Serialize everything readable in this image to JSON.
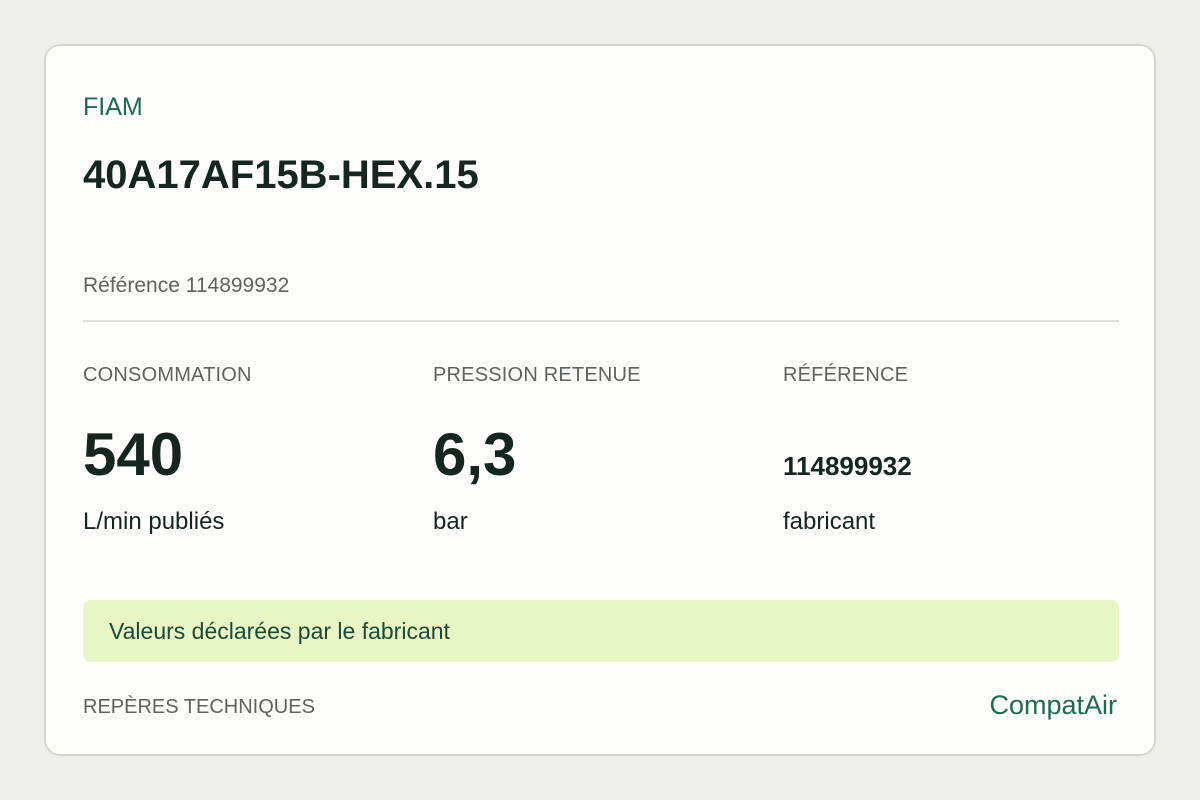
{
  "product": {
    "brand": "FIAM",
    "model": "40A17AF15B-HEX.15",
    "reference_line": "Référence 114899932"
  },
  "stats": [
    {
      "label": "CONSOMMATION",
      "value": "540",
      "unit": "L/min publiés"
    },
    {
      "label": "PRESSION RETENUE",
      "value": "6,3",
      "unit": "bar"
    },
    {
      "label": "RÉFÉRENCE",
      "value": "114899932",
      "unit": "fabricant"
    }
  ],
  "notice": "Valeurs déclarées par le fabricant",
  "footer": {
    "section_label": "REPÈRES TECHNIQUES",
    "site_name": "CompatAir"
  },
  "colors": {
    "accent": "#1f6b4e",
    "notice_background": "#e8f5c5",
    "page_background": "#efefeb"
  }
}
